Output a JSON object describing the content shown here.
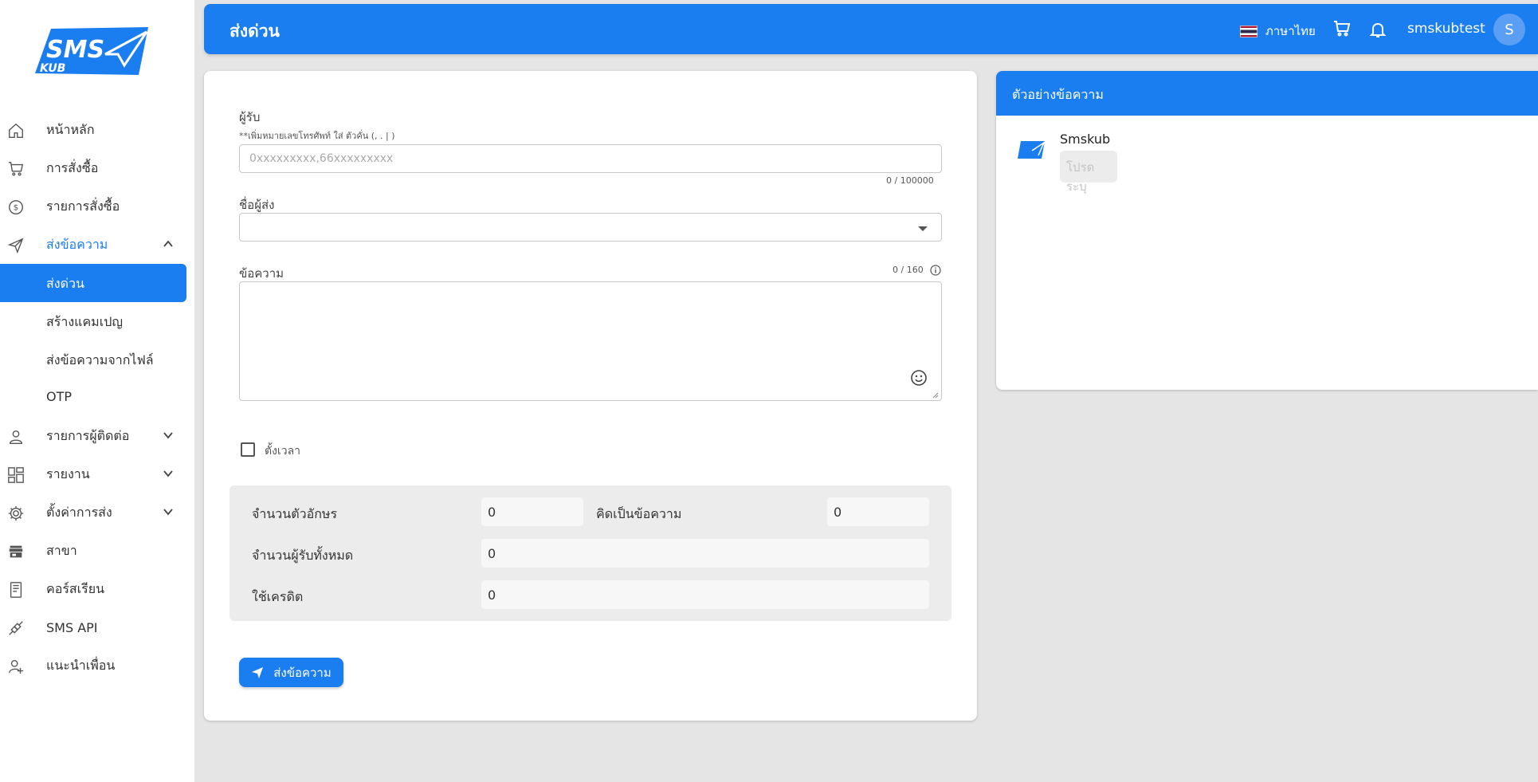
{
  "app": {
    "logo_text_top": "SMS",
    "logo_text_bottom": "KUB"
  },
  "sidebar": {
    "items": [
      {
        "label": "หน้าหลัก",
        "icon": "home-icon"
      },
      {
        "label": "การสั่งซื้อ",
        "icon": "cart-icon"
      },
      {
        "label": "รายการสั่งซื้อ",
        "icon": "dollar-icon"
      },
      {
        "label": "ส่งข้อความ",
        "icon": "send-icon",
        "expanded": true
      },
      {
        "label": "รายการผู้ติดต่อ",
        "icon": "contact-icon"
      },
      {
        "label": "รายงาน",
        "icon": "report-icon"
      },
      {
        "label": "ตั้งค่าการส่ง",
        "icon": "gear-icon"
      },
      {
        "label": "สาขา",
        "icon": "store-icon"
      },
      {
        "label": "คอร์สเรียน",
        "icon": "book-icon"
      },
      {
        "label": "SMS API",
        "icon": "api-icon"
      },
      {
        "label": "แนะนำเพื่อน",
        "icon": "add-user-icon"
      }
    ],
    "sub_items": [
      {
        "label": "ส่งด่วน",
        "active": true
      },
      {
        "label": "สร้างแคมเปญ"
      },
      {
        "label": "ส่งข้อความจากไฟล์"
      },
      {
        "label": "OTP"
      }
    ]
  },
  "header": {
    "title": "ส่งด่วน",
    "language": "ภาษาไทย",
    "username": "smskubtest",
    "avatar_initial": "S",
    "accent": "#1a7df0"
  },
  "form": {
    "recipient_label": "ผู้รับ",
    "recipient_hint": "**เพิ่มหมายเลขโทรศัพท์ ใส่ ตัวคั่น (, . | )",
    "recipient_placeholder": "0xxxxxxxxx,66xxxxxxxxx",
    "recipient_counter": "0 / 100000",
    "sender_label": "ชื่อผู้ส่ง",
    "sender_value": "",
    "message_label": "ข้อความ",
    "message_counter": "0 / 160",
    "schedule_label": "ตั้งเวลา",
    "schedule_checked": false
  },
  "summary": {
    "char_count_label": "จำนวนตัวอักษร",
    "char_count_value": "0",
    "message_count_label": "คิดเป็นข้อความ",
    "message_count_value": "0",
    "recipient_total_label": "จำนวนผู้รับทั้งหมด",
    "recipient_total_value": "0",
    "credit_label": "ใช้เครดิต",
    "credit_value": "0"
  },
  "send_button": {
    "label": "ส่งข้อความ"
  },
  "preview": {
    "title": "ตัวอย่างข้อความ",
    "sender_name": "Smskub",
    "message_placeholder": "โปรดระบุ"
  }
}
